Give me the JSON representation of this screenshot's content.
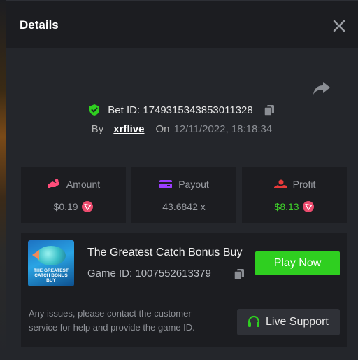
{
  "modal": {
    "title": "Details"
  },
  "bet": {
    "id_label": "Bet ID:",
    "id_value": "1749315343853011328",
    "by_label": "By",
    "user": "xrflive",
    "on_label": "On",
    "date": "12/11/2022, 18:18:34"
  },
  "stats": {
    "amount": {
      "label": "Amount",
      "value": "$0.19"
    },
    "payout": {
      "label": "Payout",
      "value": "43.6842 x"
    },
    "profit": {
      "label": "Profit",
      "value": "$8.13"
    }
  },
  "game": {
    "name": "The Greatest Catch Bonus Buy",
    "id_label": "Game ID:",
    "id_value": "1007552613379",
    "thumb_text": "THE GREATEST CATCH BONUS BUY",
    "play_label": "Play Now"
  },
  "support": {
    "message": "Any issues, please contact the customer service for help and provide the game ID.",
    "button_label": "Live Support"
  },
  "colors": {
    "accent_green": "#2fcf20",
    "profit_green": "#3fd22a",
    "coin_red": "#ec4b6e",
    "wallet_purple": "#9b3dff",
    "amount_pink": "#ff4d7a"
  },
  "icons": [
    "close-icon",
    "share-icon",
    "shield-check-icon",
    "copy-icon",
    "amount-icon",
    "wallet-icon",
    "profit-icon",
    "tron-coin-icon",
    "headset-icon"
  ]
}
